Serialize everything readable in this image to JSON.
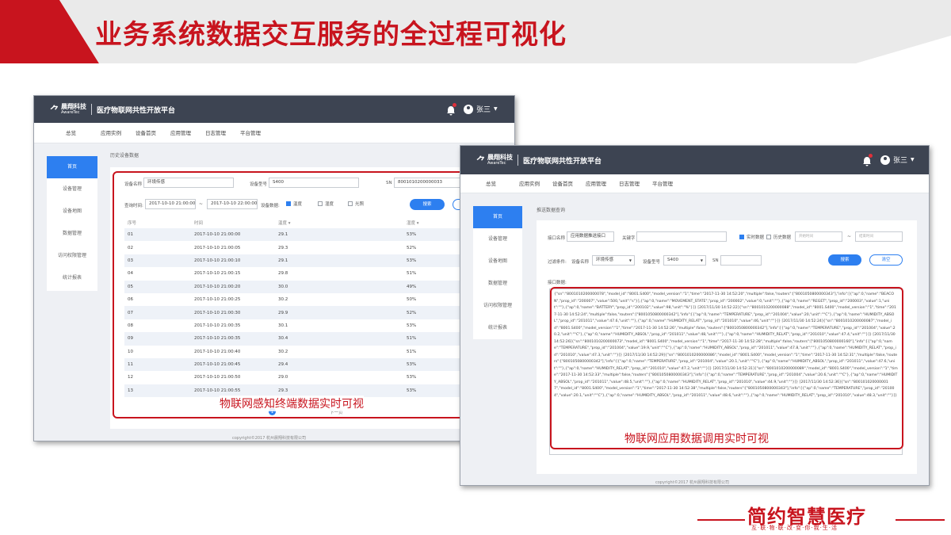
{
  "slide": {
    "title": "业务系统数据交互服务的全过程可视化",
    "brand_name": "简约智慧医疗",
    "brand_slogan": "互·联·物·联·改·变·你·我·生·活",
    "accent_color": "#c8141e"
  },
  "app": {
    "logo_cn": "晨翔科技",
    "logo_en": "AwareTec",
    "title": "医疗物联网共性开放平台",
    "user": "张三",
    "nav": [
      "总览",
      "应用实例",
      "设备首页",
      "应用管理",
      "日志管理",
      "平台管理"
    ],
    "copyright": "copyright©2017 杭州晨翔科技有限公司"
  },
  "window1": {
    "sidebar": [
      "首页",
      "设备管理",
      "设备地图",
      "数据管理",
      "访问权限管理",
      "统计报表"
    ],
    "breadcrumb": "历史设备数据",
    "filters": {
      "name_label": "设备名称",
      "name_value": "环境传感",
      "model_label": "设备型号",
      "model_value": "S400",
      "sn_label": "SN",
      "sn_value": "8001010200000033",
      "time_label": "查询时间:",
      "time_from": "2017-10-10 21:00:00",
      "time_sep": "~",
      "time_to": "2017-10-10 22:00:00",
      "data_label": "设备数据:",
      "options": [
        "温度",
        "湿度",
        "光照"
      ],
      "search_button": "搜索"
    },
    "table": {
      "headers": [
        "序号",
        "时间",
        "温度",
        "湿度"
      ],
      "rows": [
        [
          "01",
          "2017-10-10  21:00:00",
          "29.1",
          "53%"
        ],
        [
          "02",
          "2017-10-10  21:00:05",
          "29.3",
          "52%"
        ],
        [
          "03",
          "2017-10-10  21:00:10",
          "29.1",
          "53%"
        ],
        [
          "04",
          "2017-10-10  21:00:15",
          "29.8",
          "51%"
        ],
        [
          "05",
          "2017-10-10  21:00:20",
          "30.0",
          "49%"
        ],
        [
          "06",
          "2017-10-10  21:00:25",
          "30.2",
          "50%"
        ],
        [
          "07",
          "2017-10-10  21:00:30",
          "29.9",
          "52%"
        ],
        [
          "08",
          "2017-10-10  21:00:35",
          "30.1",
          "53%"
        ],
        [
          "09",
          "2017-10-10  21:00:35",
          "30.4",
          "51%"
        ],
        [
          "10",
          "2017-10-10  21:00:40",
          "30.2",
          "51%"
        ],
        [
          "11",
          "2017-10-10  21:00:45",
          "29.4",
          "53%"
        ],
        [
          "12",
          "2017-10-10  21:00:50",
          "29.0",
          "53%"
        ],
        [
          "13",
          "2017-10-10  21:00:55",
          "29.3",
          "53%"
        ]
      ]
    },
    "pager": {
      "current": "1",
      "next": "下一页"
    },
    "caption": "物联网感知终端数据实时可视"
  },
  "window2": {
    "sidebar": [
      "首页",
      "设备管理",
      "设备地图",
      "数据管理",
      "访问权限管理",
      "统计报表"
    ],
    "breadcrumb": "推送数据查询",
    "filters": {
      "api_label": "接口名称",
      "api_value": "应用数据推送接口",
      "keyword_label": "关键字",
      "realtime_label": "实时数据",
      "history_label": "历史数据",
      "date_from_placeholder": "开始时间",
      "date_sep": "~",
      "date_to_placeholder": "结束时间",
      "cond_label": "过滤条件:",
      "devname_label": "设备名称",
      "devname_value": "环境传感",
      "model_label": "设备型号",
      "model_value": "S400",
      "sn_label": "SN",
      "search_button": "搜索",
      "clear_button": "清空"
    },
    "data_label": "接口数据:",
    "json_text": "{\"sn\":\"8001010200000078\",\"model_id\":\"8001.S400\",\"model_version\":\"1\",\"time\":\"2017-11-30 14:52:20\",\"multiple\":false,\"routers\":[\"8001050800000343\"],\"info\":[{\"ap\":0,\"name\":\"BEACON\",\"prop_id\":\"200007\",\"value\":500,\"unit\":\"s\"}],{\"ap\":0,\"name\":\"MOVEMENT_STATE\",\"prop_id\":\"200002\",\"value\":0,\"unit\":\"\"},{\"ap\":0,\"name\":\"REGET\",\"prop_id\":\"200003\",\"value\":1,\"unit\":\"\"},{\"ap\":0,\"name\":\"BATTERY\",\"prop_id\":\"200102\",\"value\":98,\"unit\":\"%\"}]} [2017/11/30 14:52:22]{\"sn\":\"8001010200000088\",\"model_id\":\"8001.S400\",\"model_version\":\"1\",\"time\":\"2017-11-30 14:52:24\",\"multiple\":false,\"routers\":[\"8001050800000342\"],\"info\":[{\"ap\":0,\"name\":\"TEMPERATURE\",\"prop_id\":\"201004\",\"value\":20,\"unit\":\"°C\"},{\"ap\":0,\"name\":\"HUMIDITY_ABSOL\",\"prop_id\":\"201011\",\"value\":47.6,\"unit\":\"\"},{\"ap\":0,\"name\":\"HUMIDITY_RELAT\",\"prop_id\":\"201010\",\"value\":46,\"unit\":\"\"}]} [2017/11/30 14:52:24]{\"sn\":\"8001010200000087\",\"model_id\":\"8001.S400\",\"model_version\":\"1\",\"time\":\"2017-11-30 14:52:26\",\"multiple\":false,\"routers\":[\"8001050800000342\"],\"info\":[{\"ap\":0,\"name\":\"TEMPERATURE\",\"prop_id\":\"201004\",\"value\":20.2,\"unit\":\"°C\"},{\"ap\":0,\"name\":\"HUMIDITY_ABSOL\",\"prop_id\":\"201011\",\"value\":48,\"unit\":\"\"},{\"ap\":0,\"name\":\"HUMIDITY_RELAT\",\"prop_id\":\"201010\",\"value\":47.4,\"unit\":\"\"}]} [2017/11/30 14:52:26]{\"sn\":\"8001010200000073\",\"model_id\":\"8001.S400\",\"model_version\":\"1\",\"time\":\"2017-11-30 14:52:28\",\"multiple\":false,\"routers\":[\"8001050800000160\"],\"info\":[{\"ap\":0,\"name\":\"TEMPERATURE\",\"prop_id\":\"201004\",\"value\":19.9,\"unit\":\"°C\"},{\"ap\":0,\"name\":\"HUMIDITY_ABSOL\",\"prop_id\":\"201011\",\"value\":47.8,\"unit\":\"\"},{\"ap\":0,\"name\":\"HUMIDITY_RELAT\",\"prop_id\":\"201010\",\"value\":47.3,\"unit\":\"\"}]} [2017/11/30 14:52:29]{\"sn\":\"8001010200000086\",\"model_id\":\"8001.S400\",\"model_version\":\"1\",\"time\":\"2017-11-30 14:52:31\",\"multiple\":false,\"routers\":[\"8001050800000342\"],\"info\":[{\"ap\":0,\"name\":\"TEMPERATURE\",\"prop_id\":\"201004\",\"value\":20.1,\"unit\":\"°C\"},{\"ap\":0,\"name\":\"HUMIDITY_ABSOL\",\"prop_id\":\"201011\",\"value\":47.6,\"unit\":\"\"},{\"ap\":0,\"name\":\"HUMIDITY_RELAT\",\"prop_id\":\"201010\",\"value\":47.2,\"unit\":\"\"}]} [2017/11/30 14:52:31]{\"sn\":\"8001010200000089\",\"model_id\":\"8001.S400\",\"model_version\":\"1\",\"time\":\"2017-11-30 14:52:33\",\"multiple\":false,\"routers\":[\"8001050800000343\"],\"info\":[{\"ap\":0,\"name\":\"TEMPERATURE\",\"prop_id\":\"201004\",\"value\":20.6,\"unit\":\"°C\"},{\"ap\":0,\"name\":\"HUMIDITY_ABSOL\",\"prop_id\":\"201011\",\"value\":48.5,\"unit\":\"\"},{\"ap\":0,\"name\":\"HUMIDITY_RELAT\",\"prop_id\":\"201010\",\"value\":44.9,\"unit\":\"\"}]} [2017/11/30 14:52:36]{\"sn\":\"8001010200000017\",\"model_id\":\"8001.S400\",\"model_version\":\"1\",\"time\":\"2017-11-30 14:52:38\",\"multiple\":false,\"routers\":[\"8001050800000343\"],\"info\":[{\"ap\":0,\"name\":\"TEMPERATURE\",\"prop_id\":\"201004\",\"value\":20.1,\"unit\":\"°C\"},{\"ap\":0,\"name\":\"HUMIDITY_ABSOL\",\"prop_id\":\"201011\",\"value\":48.6,\"unit\":\"\"},{\"ap\":0,\"name\":\"HUMIDITY_RELAT\",\"prop_id\":\"201010\",\"value\":48.3,\"unit\":\"\"}]}",
    "caption": "物联网应用数据调用实时可视"
  }
}
